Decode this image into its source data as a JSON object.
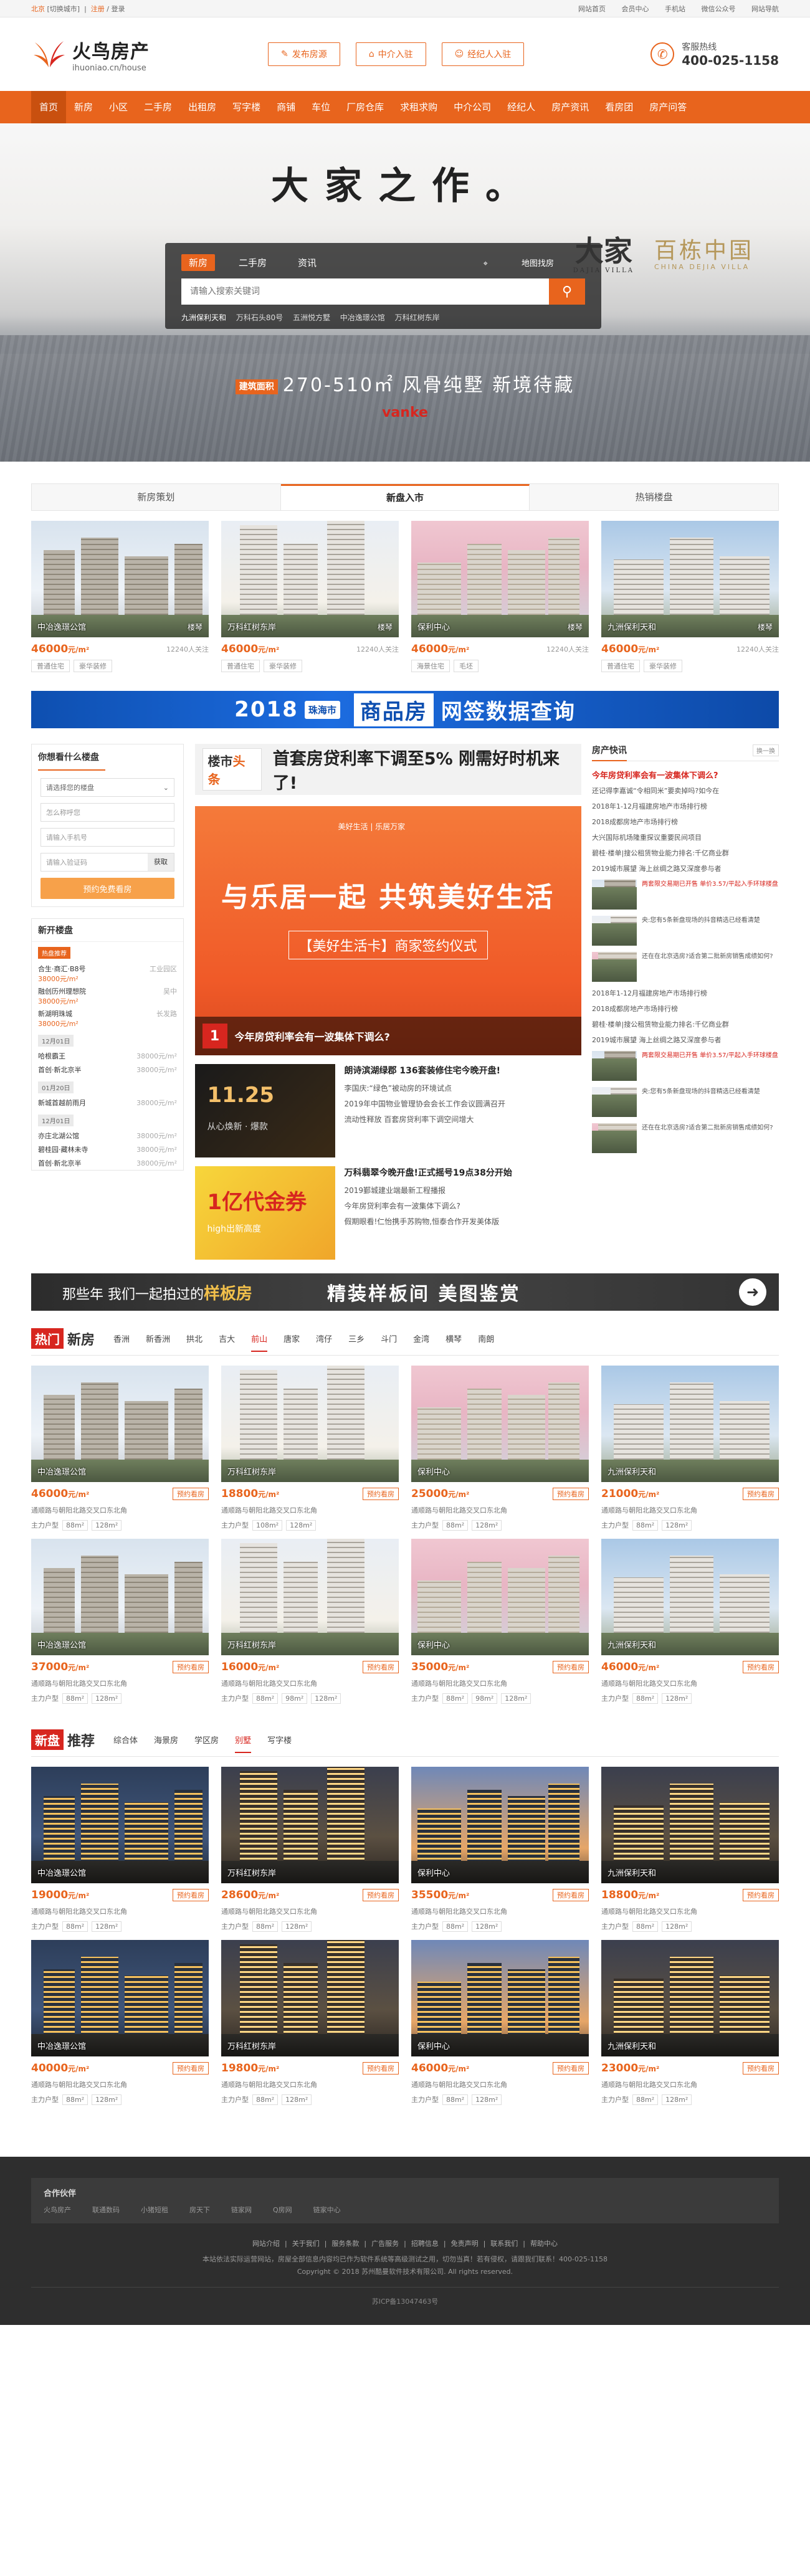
{
  "topbar": {
    "city": "北京",
    "switch_city": "[切换城市]",
    "login": "注册",
    "register": "登录",
    "links": [
      "网站首页",
      "会员中心",
      "手机站",
      "微信公众号",
      "网站导航"
    ]
  },
  "header": {
    "logo_cn": "火鸟房产",
    "logo_url": "ihuoniao.cn/house",
    "btn_publish": "发布房源",
    "btn_agent": "中介入驻",
    "btn_broker": "经纪人入驻",
    "hotline_label": "客服热线",
    "hotline_number": "400-025-1158"
  },
  "nav": [
    "首页",
    "新房",
    "小区",
    "二手房",
    "出租房",
    "写字楼",
    "商铺",
    "车位",
    "厂房仓库",
    "求租求购",
    "中介公司",
    "经纪人",
    "房产资讯",
    "看房团",
    "房产问答"
  ],
  "banner": {
    "slogan": "大家之作。",
    "tabs": [
      "新房",
      "二手房",
      "资讯"
    ],
    "map_search": "地图找房",
    "search_placeholder": "请输入搜索关键词",
    "hot": [
      "九洲保利天和",
      "万科石头80号",
      "五洲悦方墅",
      "中冶逸璟公馆",
      "万科红树东岸"
    ],
    "brand_cal": "大家",
    "brand_cal_sub": "DAJIA VILLA",
    "brand_cn": "百栋中国",
    "brand_en": "CHINA DEJIA VILLA",
    "promo_badge": "建筑面积",
    "promo_text": "270-510㎡ 风骨纯墅  新境待藏",
    "vanke": "vanke"
  },
  "recommend_tabs": [
    "新房策划",
    "新盘入市",
    "热销楼盘"
  ],
  "recommend_cards": [
    {
      "name": "中冶逸璟公馆",
      "tag": "楼琴",
      "price": "46000",
      "unit": "元/m²",
      "attention": "12240人关注",
      "tags": [
        "普通住宅",
        "豪华装修"
      ]
    },
    {
      "name": "万科红树东岸",
      "tag": "楼琴",
      "price": "46000",
      "unit": "元/m²",
      "attention": "12240人关注",
      "tags": [
        "普通住宅",
        "豪华装修"
      ]
    },
    {
      "name": "保利中心",
      "tag": "楼琴",
      "price": "46000",
      "unit": "元/m²",
      "attention": "12240人关注",
      "tags": [
        "海景住宅",
        "毛坯"
      ]
    },
    {
      "name": "九洲保利天和",
      "tag": "楼琴",
      "price": "46000",
      "unit": "元/m²",
      "attention": "12240人关注",
      "tags": [
        "普通住宅",
        "豪华装修"
      ]
    }
  ],
  "data_banner": {
    "year": "2018",
    "city": "珠海市",
    "hl": "商品房",
    "rest": "网签数据查询"
  },
  "left": {
    "find_title": "你想看什么楼盘",
    "select_placeholder": "请选择您的楼盘",
    "name_placeholder": "怎么称呼您",
    "phone_placeholder": "请输入手机号",
    "code_placeholder": "请输入验证码",
    "code_btn": "获取",
    "submit": "预约免费看房",
    "open_title": "新开楼盘",
    "hot_badge": "热盘推荐",
    "open_items": [
      {
        "name": "合生·商汇·B8号",
        "area": "工业园区",
        "price": "38000元/m²"
      },
      {
        "name": "融创历州理想院",
        "area": "吴中",
        "price": "38000元/m²"
      },
      {
        "name": "新湖明珠城",
        "area": "长发路",
        "price": "38000元/m²"
      }
    ],
    "dates": [
      {
        "date": "12月01日",
        "rows": [
          {
            "name": "哈根霸王",
            "price": "38000元/m²"
          },
          {
            "name": "首创·新北京半",
            "price": "38000元/m²"
          }
        ]
      },
      {
        "date": "01月20日",
        "rows": [
          {
            "name": "新城首越前雨月",
            "price": "38000元/m²"
          }
        ]
      },
      {
        "date": "12月01日",
        "rows": [
          {
            "name": "亦庄北湖公馆",
            "price": "38000元/m²"
          },
          {
            "name": "碧桂园·藏林未寺",
            "price": "38000元/m²"
          },
          {
            "name": "首创·新北京半",
            "price": "38000元/m²"
          }
        ]
      }
    ]
  },
  "mid": {
    "logo_a": "楼市",
    "logo_b": "头条",
    "headline": "首套房贷利率下调至5% 刚需好时机来了!",
    "big_t1": "与乐居一起 共筑美好生活",
    "big_t2": "【美好生活卡】商家签约仪式",
    "big_logos": "美好生活 | 乐居万家",
    "big_num": "1",
    "big_cap": "今年房贷利率会有一波集体下调么?",
    "items": [
      {
        "pic_title": "11.25",
        "pic_sub": "从心焕新 · 爆款",
        "h": "朗诗滨湖绿郡 136套装修住宅今晚开盘!",
        "l": [
          "李国庆:“绿色”被动房的环境试点",
          "2019年中国物业管理协会会长工作会议圆满召开",
          "流动性释放 百套房贷利率下调空间增大"
        ]
      },
      {
        "pic_title": "1亿代金券",
        "pic_sub": "high出新高度",
        "h": "万科翡翠今晚开盘!正式摇号19点38分开始",
        "l": [
          "2019鄞城建业端最新工程播报",
          "今年房贷利率会有一波集体下调么?",
          "假期眼看!仁怡携手苏购物,恒泰合作开发美体版"
        ]
      }
    ]
  },
  "right": {
    "title": "房产快讯",
    "more": "换一换",
    "top": "今年房贷利率会有一波集体下调么?",
    "list1": [
      "还记得李嘉诚“令相同米”要卖掉吗?如今在",
      "2018年1-12月福建房地产市场排行榜",
      "2018成都房地产市场排行榜",
      "大兴国际机场隆重探议重要民间项目",
      "碧桂·楼单|搜公租赁物业能力排名:千亿商业群",
      "2019城市展望  海上丝绸之路又深度参与者"
    ],
    "pics": [
      {
        "t": "两套限交易期已开售 单价3.57/平起入手环球楼盘",
        "s": ""
      },
      {
        "t": "央:您有5条新盘现场的抖音精选已经看清楚",
        "s": ""
      },
      {
        "t": "还在在北京选房?适合第二批新房销售成绩如何?",
        "s": ""
      }
    ],
    "list2": [
      "2018年1-12月福建房地产市场排行榜",
      "2018成都房地产市场排行榜",
      "碧桂·楼单|搜公租赁物业能力排名:千亿商业群",
      "2019城市展望  海上丝绸之路又深度参与者"
    ],
    "pics2": [
      {
        "t": "两套限交易期已开售 单价3.57/平起入手环球楼盘"
      },
      {
        "t": "央:您有5条新盘现场的抖音精选已经看清楚"
      },
      {
        "t": "还在在北京选房?适合第二批新房销售成绩如何?"
      }
    ]
  },
  "strip": {
    "s1a": "那些年 我们一起拍过的",
    "s1b": "样板房",
    "s2": "精装样板间 美图鉴赏"
  },
  "hot_new": {
    "lbl": "热门",
    "title": "新房",
    "areas": [
      "香洲",
      "新香洲",
      "拱北",
      "吉大",
      "前山",
      "唐家",
      "湾仔",
      "三乡",
      "斗门",
      "金湾",
      "横琴",
      "南朗"
    ],
    "active_area": "前山",
    "cards": [
      {
        "name": "中冶逸璟公馆",
        "price": "46000",
        "unit": "元/m²",
        "book": "预约看房",
        "addr": "通顺路与朝阳北路交叉口东北角",
        "layout_lbl": "主力户型",
        "layouts": [
          "88m²",
          "128m²"
        ]
      },
      {
        "name": "万科红树东岸",
        "price": "18800",
        "unit": "元/m²",
        "book": "预约看房",
        "addr": "通顺路与朝阳北路交叉口东北角",
        "layout_lbl": "主力户型",
        "layouts": [
          "108m²",
          "128m²"
        ]
      },
      {
        "name": "保利中心",
        "price": "25000",
        "unit": "元/m²",
        "book": "预约看房",
        "addr": "通顺路与朝阳北路交叉口东北角",
        "layout_lbl": "主力户型",
        "layouts": [
          "88m²",
          "128m²"
        ]
      },
      {
        "name": "九洲保利天和",
        "price": "21000",
        "unit": "元/m²",
        "book": "预约看房",
        "addr": "通顺路与朝阳北路交叉口东北角",
        "layout_lbl": "主力户型",
        "layouts": [
          "88m²",
          "128m²"
        ]
      },
      {
        "name": "中冶逸璟公馆",
        "price": "37000",
        "unit": "元/m²",
        "book": "预约看房",
        "addr": "通顺路与朝阳北路交叉口东北角",
        "layout_lbl": "主力户型",
        "layouts": [
          "88m²",
          "128m²"
        ]
      },
      {
        "name": "万科红树东岸",
        "price": "16000",
        "unit": "元/m²",
        "book": "预约看房",
        "addr": "通顺路与朝阳北路交叉口东北角",
        "layout_lbl": "主力户型",
        "layouts": [
          "88m²",
          "98m²",
          "128m²"
        ]
      },
      {
        "name": "保利中心",
        "price": "35000",
        "unit": "元/m²",
        "book": "预约看房",
        "addr": "通顺路与朝阳北路交叉口东北角",
        "layout_lbl": "主力户型",
        "layouts": [
          "88m²",
          "98m²",
          "128m²"
        ]
      },
      {
        "name": "九洲保利天和",
        "price": "46000",
        "unit": "元/m²",
        "book": "预约看房",
        "addr": "通顺路与朝阳北路交叉口东北角",
        "layout_lbl": "主力户型",
        "layouts": [
          "88m²",
          "128m²"
        ]
      }
    ]
  },
  "new_rec": {
    "lbl": "新盘",
    "title": "推荐",
    "areas": [
      "综合体",
      "海景房",
      "学区房",
      "别墅",
      "写字楼"
    ],
    "active_area": "别墅",
    "cards": [
      {
        "name": "中冶逸璟公馆",
        "price": "19000",
        "unit": "元/m²",
        "book": "预约看房",
        "addr": "通顺路与朝阳北路交叉口东北角",
        "layout_lbl": "主力户型",
        "layouts": [
          "88m²",
          "128m²"
        ]
      },
      {
        "name": "万科红树东岸",
        "price": "28600",
        "unit": "元/m²",
        "book": "预约看房",
        "addr": "通顺路与朝阳北路交叉口东北角",
        "layout_lbl": "主力户型",
        "layouts": [
          "88m²",
          "128m²"
        ]
      },
      {
        "name": "保利中心",
        "price": "35500",
        "unit": "元/m²",
        "book": "预约看房",
        "addr": "通顺路与朝阳北路交叉口东北角",
        "layout_lbl": "主力户型",
        "layouts": [
          "88m²",
          "128m²"
        ]
      },
      {
        "name": "九洲保利天和",
        "price": "18800",
        "unit": "元/m²",
        "book": "预约看房",
        "addr": "通顺路与朝阳北路交叉口东北角",
        "layout_lbl": "主力户型",
        "layouts": [
          "88m²",
          "128m²"
        ]
      },
      {
        "name": "中冶逸璟公馆",
        "price": "40000",
        "unit": "元/m²",
        "book": "预约看房",
        "addr": "通顺路与朝阳北路交叉口东北角",
        "layout_lbl": "主力户型",
        "layouts": [
          "88m²",
          "128m²"
        ]
      },
      {
        "name": "万科红树东岸",
        "price": "19800",
        "unit": "元/m²",
        "book": "预约看房",
        "addr": "通顺路与朝阳北路交叉口东北角",
        "layout_lbl": "主力户型",
        "layouts": [
          "88m²",
          "128m²"
        ]
      },
      {
        "name": "保利中心",
        "price": "46000",
        "unit": "元/m²",
        "book": "预约看房",
        "addr": "通顺路与朝阳北路交叉口东北角",
        "layout_lbl": "主力户型",
        "layouts": [
          "88m²",
          "128m²"
        ]
      },
      {
        "name": "九洲保利天和",
        "price": "23000",
        "unit": "元/m²",
        "book": "预约看房",
        "addr": "通顺路与朝阳北路交叉口东北角",
        "layout_lbl": "主力户型",
        "layouts": [
          "88m²",
          "128m²"
        ]
      }
    ]
  },
  "footer": {
    "partner_title": "合作伙伴",
    "partners": [
      "火鸟房产",
      "联通数码",
      "小猪短租",
      "房天下",
      "链家网",
      "Q房网",
      "链家中心"
    ],
    "nav": [
      "网站介绍",
      "关于我们",
      "服务条款",
      "广告服务",
      "招聘信息",
      "免责声明",
      "联系我们",
      "帮助中心"
    ],
    "copy1": "本站依法实际运营网站，房屋全部信息内容均已作为软件系统等高级测试之用，切勿当真！若有侵权，请跟我们联系！400-025-1158",
    "copy2": "Copyright © 2018 苏州酷曼软件技术有限公司. All rights reserved.",
    "icp": "苏ICP备13047463号"
  },
  "colors": {
    "accent": "#e8641d",
    "red": "#d7261f",
    "blue": "#0e4fb0"
  }
}
